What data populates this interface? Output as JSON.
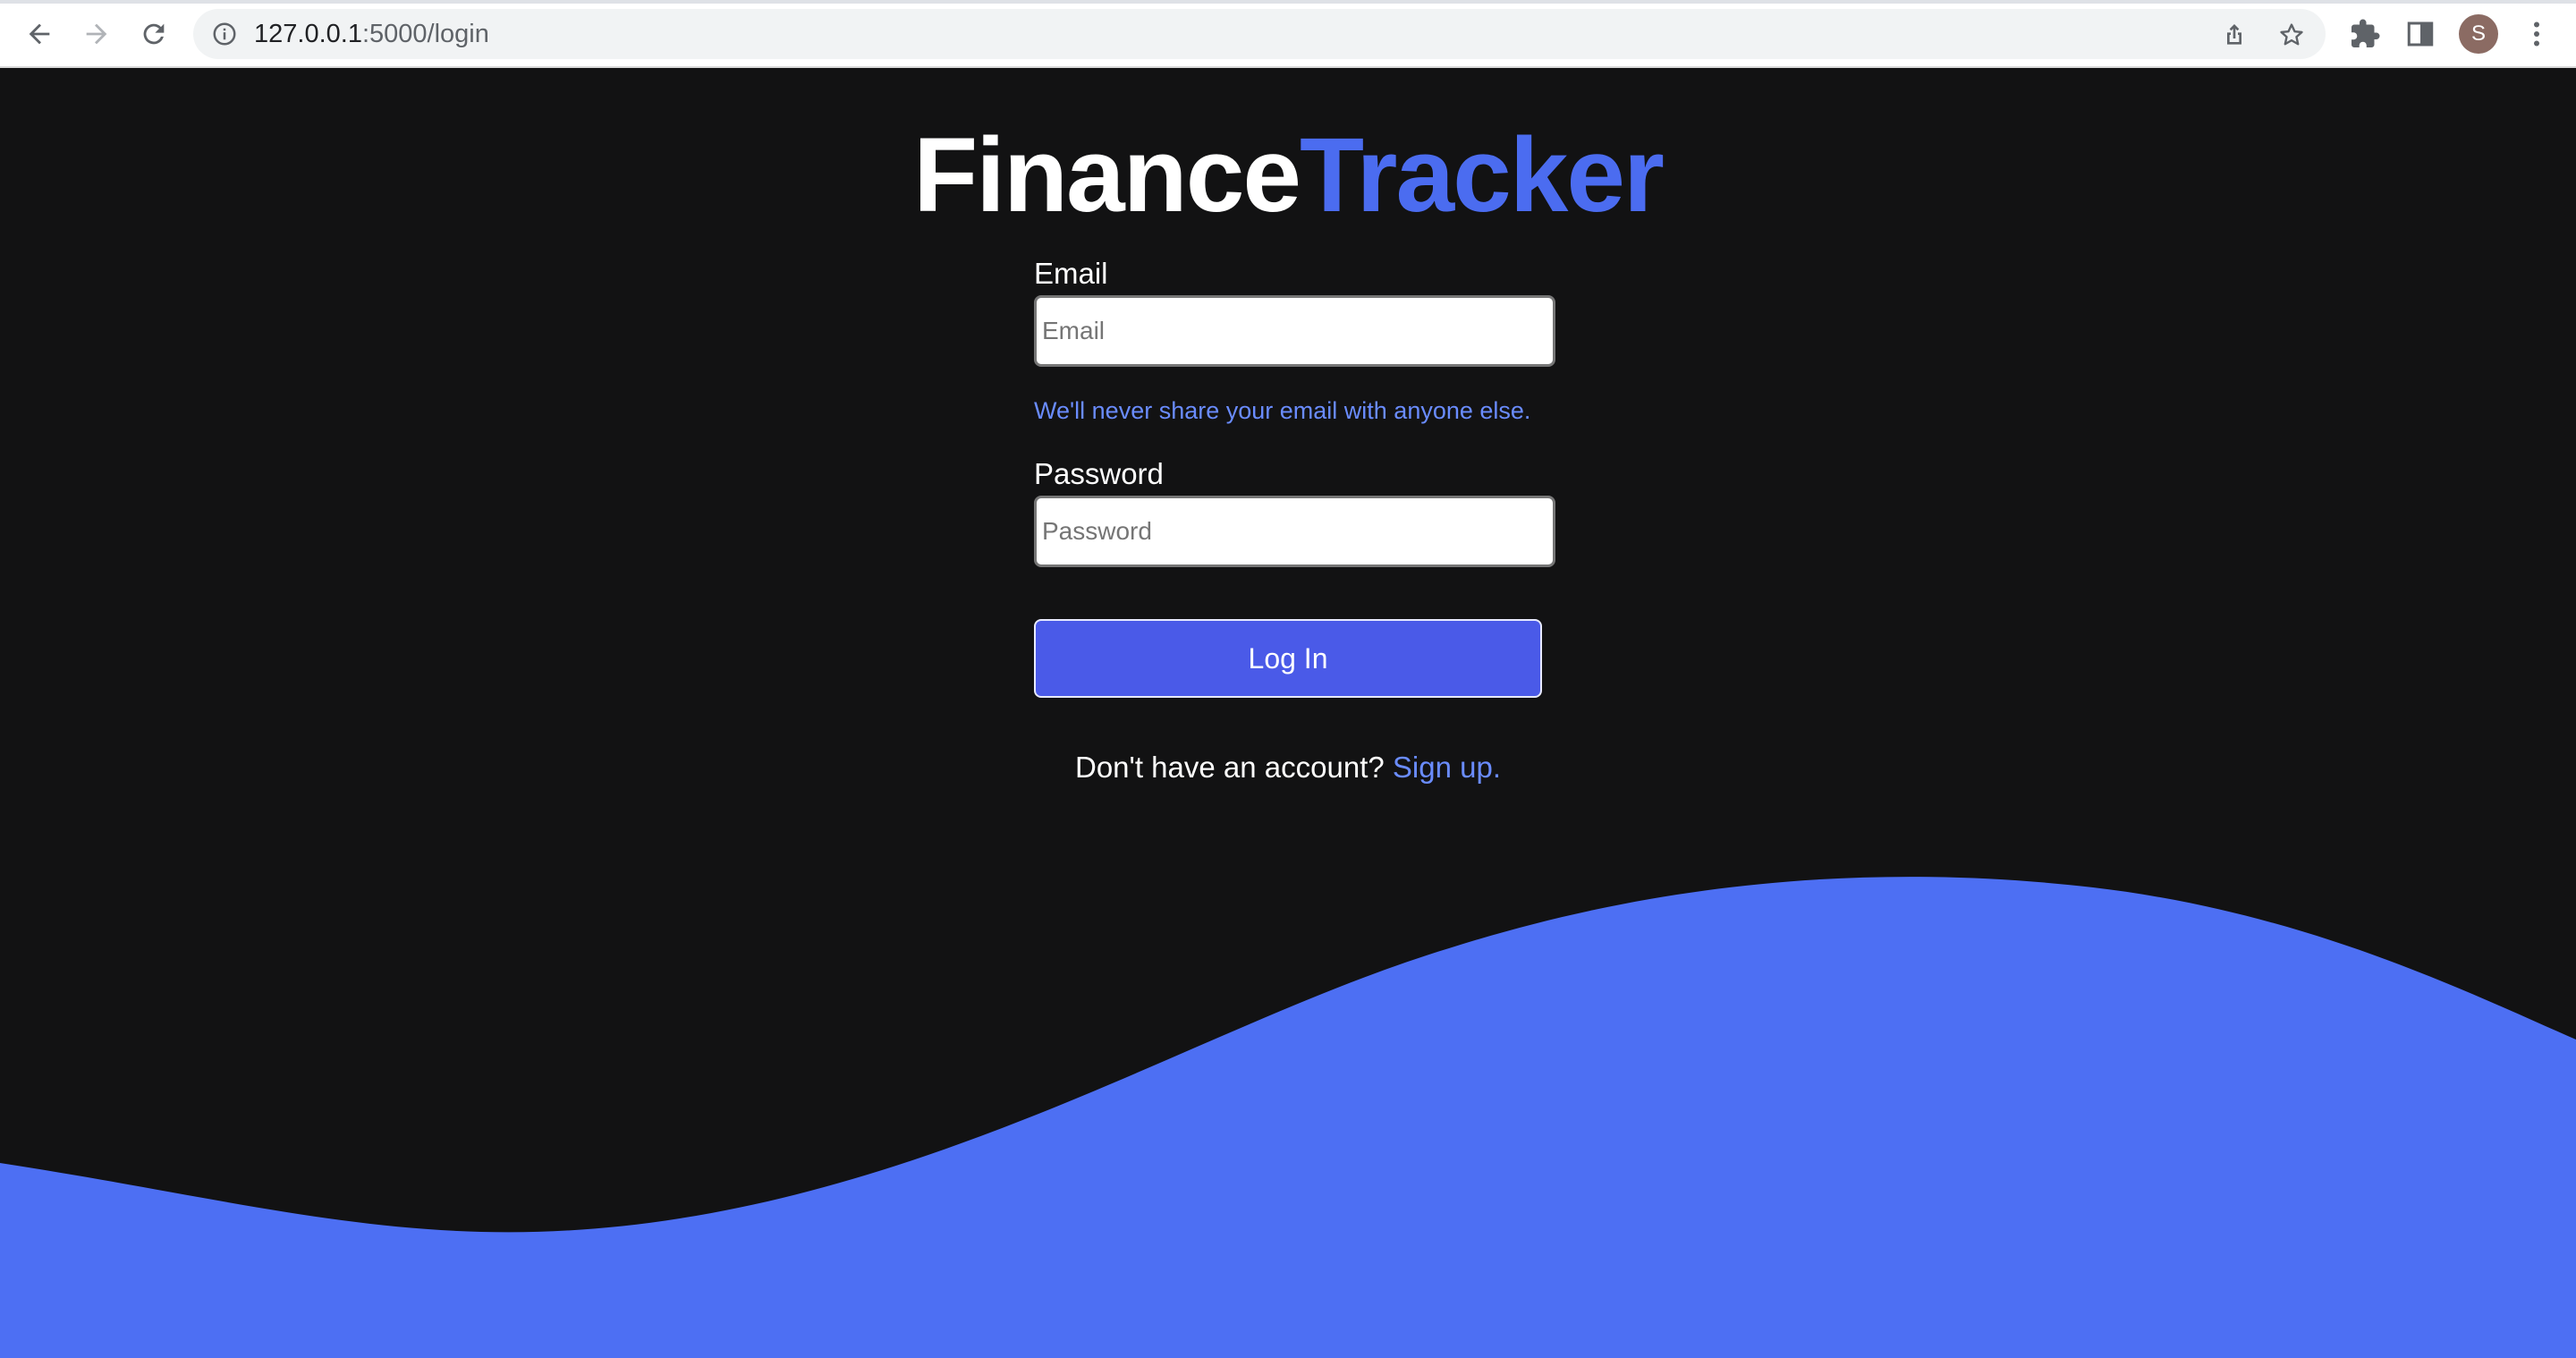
{
  "browser": {
    "url_host": "127.0.0.1",
    "url_path": ":5000/login",
    "avatar_letter": "S",
    "icons": [
      "back-icon",
      "forward-icon",
      "reload-icon",
      "info-icon",
      "share-icon",
      "star-icon",
      "extensions-icon",
      "side-panel-icon",
      "more-icon"
    ]
  },
  "brand": {
    "part1": "Finance",
    "part2": "Tracker",
    "color_primary": "#ffffff",
    "color_accent": "#4b6cf0"
  },
  "form": {
    "email_label": "Email",
    "email_placeholder": "Email",
    "email_value": "",
    "email_hint": "We'll never share your email with anyone else.",
    "password_label": "Password",
    "password_placeholder": "Password",
    "password_value": "",
    "submit_label": "Log In"
  },
  "footer": {
    "prompt": "Don't have an account?",
    "link": "Sign up."
  },
  "colors": {
    "background": "#121213",
    "wave": "#4d6ff3",
    "button": "#4a5ae8"
  }
}
